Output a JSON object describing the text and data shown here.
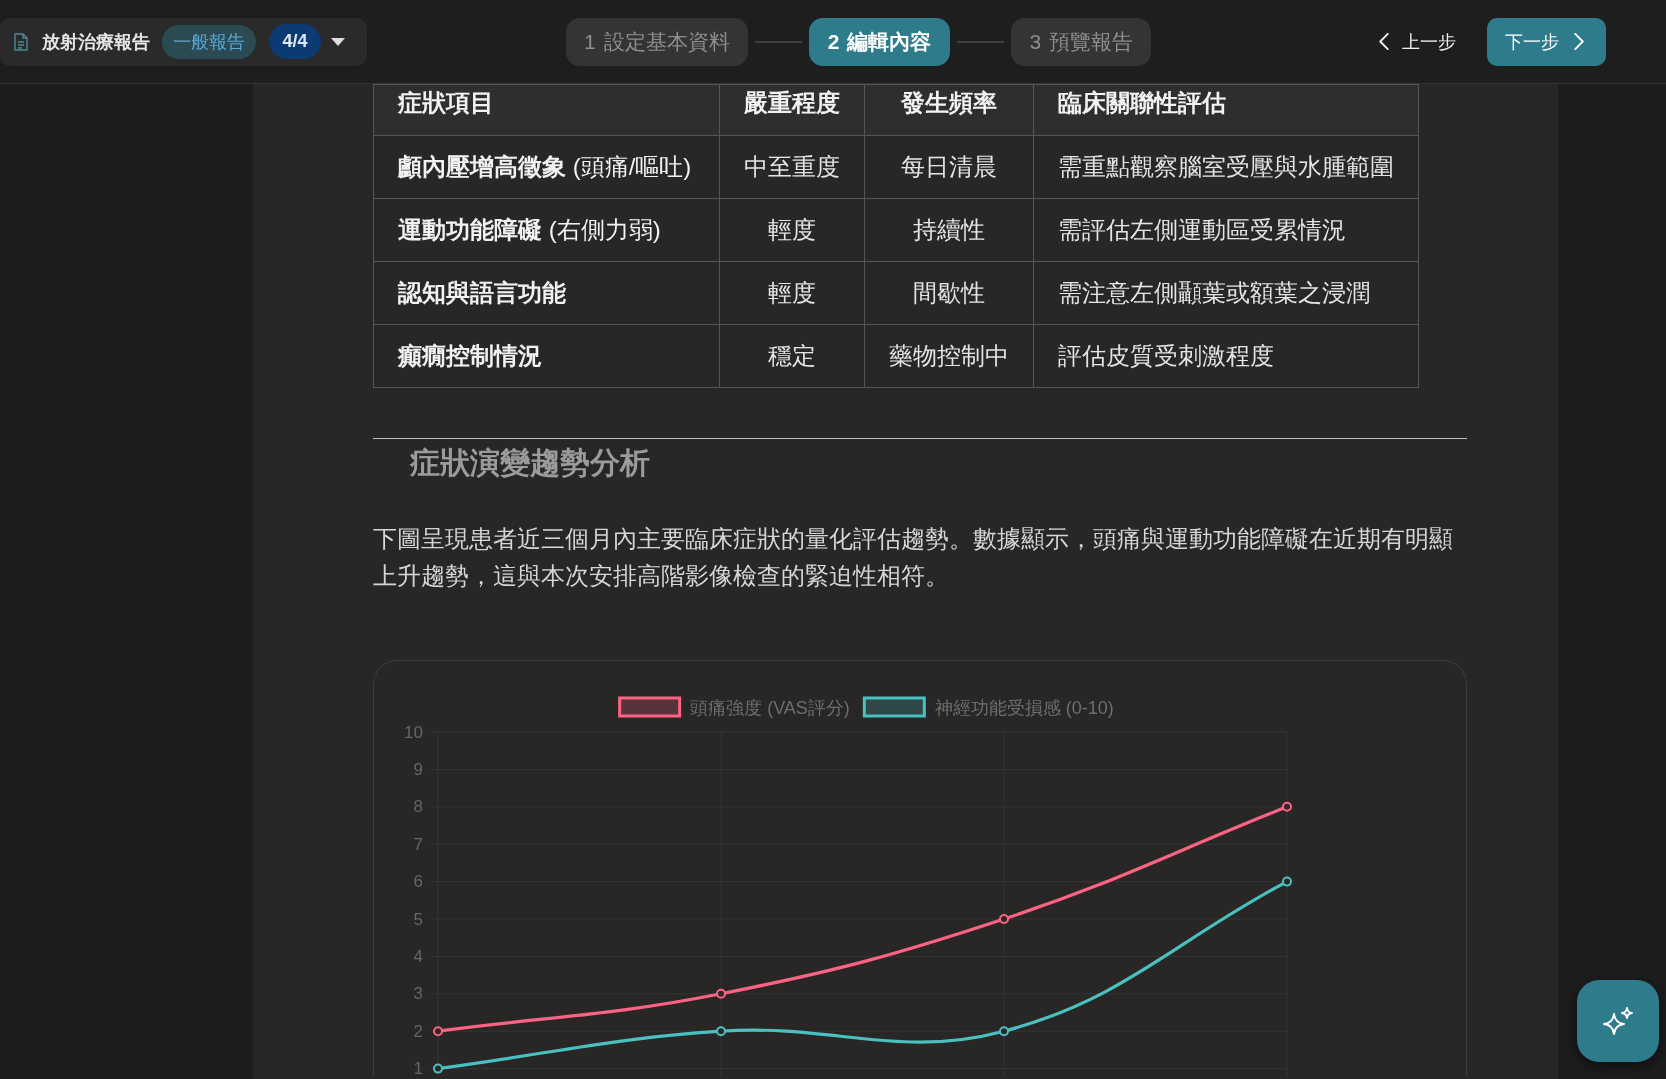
{
  "header": {
    "title": "放射治療報告",
    "report_type": "一般報告",
    "page_count": "4/4"
  },
  "steps": [
    {
      "number": "1",
      "label": "設定基本資料",
      "selected": false
    },
    {
      "number": "2",
      "label": "編輯內容",
      "selected": true
    },
    {
      "number": "3",
      "label": "預覽報告",
      "selected": false
    }
  ],
  "navigation": {
    "previous": "上一步",
    "next": "下一步"
  },
  "symptom_table": {
    "columns": [
      "症狀項目",
      "嚴重程度",
      "發生頻率",
      "臨床關聯性評估"
    ],
    "rows": [
      {
        "symptom": "顱內壓增高徵象",
        "symptom_note": "(頭痛/嘔吐)",
        "severity": "中至重度",
        "frequency": "每日清晨",
        "assessment": "需重點觀察腦室受壓與水腫範圍"
      },
      {
        "symptom": "運動功能障礙",
        "symptom_note": "(右側力弱)",
        "severity": "輕度",
        "frequency": "持續性",
        "assessment": "需評估左側運動區受累情況"
      },
      {
        "symptom": "認知與語言功能",
        "severity": "輕度",
        "frequency": "間歇性",
        "assessment": "需注意左側顳葉或額葉之浸潤"
      },
      {
        "symptom": "癲癇控制情況",
        "severity": "穩定",
        "frequency": "藥物控制中",
        "assessment": "評估皮質受刺激程度"
      }
    ]
  },
  "section": {
    "heading": "症狀演變趨勢分析",
    "paragraph": "下圖呈現患者近三個月內主要臨床症狀的量化評估趨勢。數據顯示，頭痛與運動功能障礙在近期有明顯上升趨勢，這與本次安排高階影像檢查的緊迫性相符。"
  },
  "chart": {
    "chart_data": {
      "type": "line",
      "legend": "top",
      "grid": true,
      "series": [
        {
          "name": "頭痛強度 (VAS評分)",
          "color": "#ff6384",
          "marker": "circle",
          "values": [
            2,
            3,
            5,
            8
          ]
        },
        {
          "name": "神經功能受損感 (0-10)",
          "color": "#4bc0c0",
          "marker": "circle",
          "values": [
            1,
            2,
            2,
            6
          ]
        }
      ],
      "ylim": [
        1,
        10
      ],
      "yticks": [
        1,
        2,
        3,
        4,
        5,
        6,
        7,
        8,
        9,
        10
      ]
    }
  }
}
